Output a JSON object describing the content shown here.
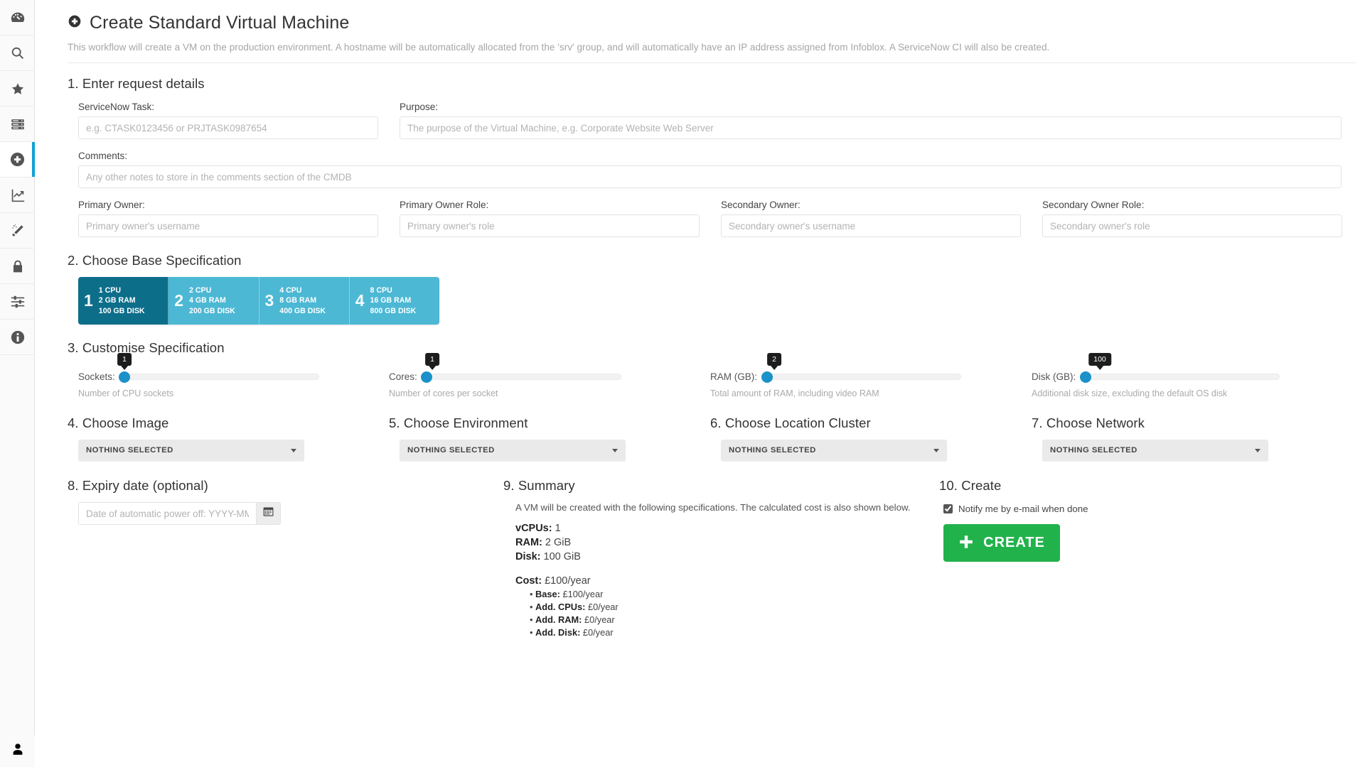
{
  "sidebar": {
    "items": [
      {
        "icon": "dashboard-icon",
        "name": "sidebar-item-dashboard"
      },
      {
        "icon": "search-icon",
        "name": "sidebar-item-search"
      },
      {
        "icon": "star-icon",
        "name": "sidebar-item-favourites"
      },
      {
        "icon": "server-icon",
        "name": "sidebar-item-servers"
      },
      {
        "icon": "plus-circle-icon",
        "name": "sidebar-item-create"
      },
      {
        "icon": "chart-line-icon",
        "name": "sidebar-item-analytics"
      },
      {
        "icon": "magic-wand-icon",
        "name": "sidebar-item-tools"
      },
      {
        "icon": "lock-icon",
        "name": "sidebar-item-security"
      },
      {
        "icon": "sliders-icon",
        "name": "sidebar-item-settings"
      },
      {
        "icon": "info-circle-icon",
        "name": "sidebar-item-about"
      }
    ],
    "active_index": 4,
    "user_icon": "user-icon",
    "accent_color": "#0fa2d6"
  },
  "header": {
    "icon": "plus-circle-icon",
    "title": "Create Standard Virtual Machine",
    "description": "This workflow will create a VM on the production environment. A hostname will be automatically allocated from the 'srv' group, and will automatically have an IP address assigned from Infoblox. A ServiceNow CI will also be created."
  },
  "section1": {
    "heading": "1. Enter request details",
    "servicenow_task": {
      "label": "ServiceNow Task:",
      "placeholder": "e.g. CTASK0123456 or PRJTASK0987654",
      "value": ""
    },
    "purpose": {
      "label": "Purpose:",
      "placeholder": "The purpose of the Virtual Machine, e.g. Corporate Website Web Server",
      "value": ""
    },
    "comments": {
      "label": "Comments:",
      "placeholder": "Any other notes to store in the comments section of the CMDB",
      "value": ""
    },
    "primary_owner": {
      "label": "Primary Owner:",
      "placeholder": "Primary owner's username",
      "value": ""
    },
    "primary_owner_role": {
      "label": "Primary Owner Role:",
      "placeholder": "Primary owner's role",
      "value": ""
    },
    "secondary_owner": {
      "label": "Secondary Owner:",
      "placeholder": "Secondary owner's username",
      "value": ""
    },
    "secondary_owner_role": {
      "label": "Secondary Owner Role:",
      "placeholder": "Secondary owner's role",
      "value": ""
    }
  },
  "section2": {
    "heading": "2. Choose Base Specification",
    "selected_index": 0,
    "selected_color": "#0d6e8a",
    "unselected_color": "#4cb8d4",
    "cards": [
      {
        "num": "1",
        "cpu": "1 CPU",
        "ram": "2 GB RAM",
        "disk": "100 GB DISK"
      },
      {
        "num": "2",
        "cpu": "2 CPU",
        "ram": "4 GB RAM",
        "disk": "200 GB DISK"
      },
      {
        "num": "3",
        "cpu": "4 CPU",
        "ram": "8 GB RAM",
        "disk": "400 GB DISK"
      },
      {
        "num": "4",
        "cpu": "8 CPU",
        "ram": "16 GB RAM",
        "disk": "800 GB DISK"
      }
    ]
  },
  "section3": {
    "heading": "3. Customise Specification",
    "knob_color": "#1a91c9",
    "sliders": [
      {
        "label": "Sockets:",
        "value": "1",
        "help": "Number of CPU sockets",
        "percent": 2
      },
      {
        "label": "Cores:",
        "value": "1",
        "help": "Number of cores per socket",
        "percent": 2
      },
      {
        "label": "RAM (GB):",
        "value": "2",
        "help": "Total amount of RAM, including video RAM",
        "percent": 2
      },
      {
        "label": "Disk (GB):",
        "value": "100",
        "help": "Additional disk size, excluding the default OS disk",
        "percent": 2
      }
    ]
  },
  "dropdowns": [
    {
      "heading": "4. Choose Image",
      "value": "NOTHING SELECTED",
      "name": "image-dropdown"
    },
    {
      "heading": "5. Choose Environment",
      "value": "NOTHING SELECTED",
      "name": "environment-dropdown"
    },
    {
      "heading": "6. Choose Location Cluster",
      "value": "NOTHING SELECTED",
      "name": "location-cluster-dropdown"
    },
    {
      "heading": "7. Choose Network",
      "value": "NOTHING SELECTED",
      "name": "network-dropdown"
    }
  ],
  "section8": {
    "heading": "8. Expiry date (optional)",
    "placeholder": "Date of automatic power off: YYYY-MM-DD",
    "value": "",
    "calendar_icon": "calendar-icon"
  },
  "section9": {
    "heading": "9. Summary",
    "description": "A VM will be created with the following specifications. The calculated cost is also shown below.",
    "specs": [
      {
        "label": "vCPUs:",
        "value": "1"
      },
      {
        "label": "RAM:",
        "value": "2 GiB"
      },
      {
        "label": "Disk:",
        "value": "100 GiB"
      }
    ],
    "cost_label": "Cost:",
    "cost_value": "£100/year",
    "cost_breakdown": [
      {
        "label": "Base:",
        "value": "£100/year"
      },
      {
        "label": "Add. CPUs:",
        "value": "£0/year"
      },
      {
        "label": "Add. RAM:",
        "value": "£0/year"
      },
      {
        "label": "Add. Disk:",
        "value": "£0/year"
      }
    ]
  },
  "section10": {
    "heading": "10. Create",
    "notify_label": "Notify me by e-mail when done",
    "notify_checked": true,
    "create_label": "CREATE",
    "create_color": "#22b24c"
  }
}
